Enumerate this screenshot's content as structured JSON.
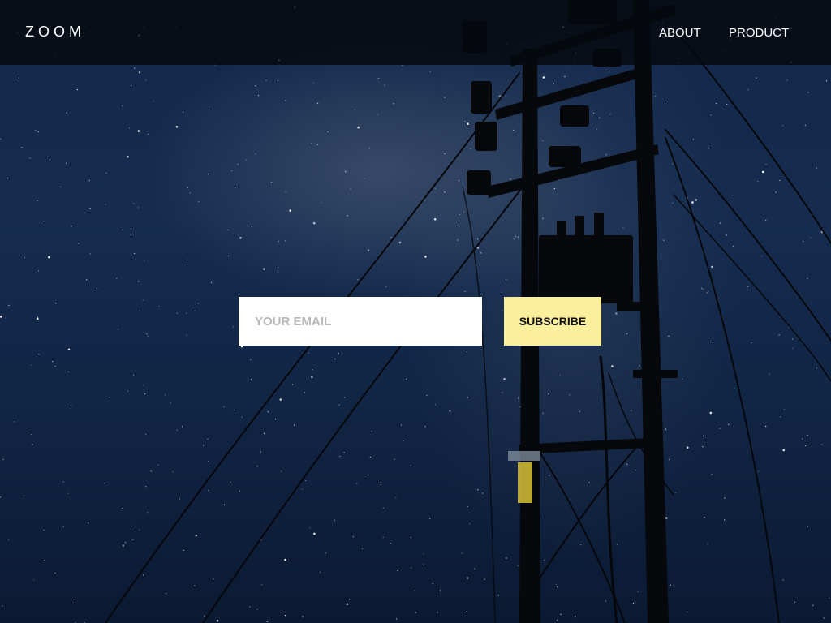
{
  "header": {
    "logo": "ZOOM",
    "nav": [
      {
        "label": "ABOUT"
      },
      {
        "label": "PRODUCT"
      }
    ]
  },
  "signup": {
    "email_placeholder": "YOUR EMAIL",
    "email_value": "",
    "subscribe_label": "SUBSCRIBE"
  },
  "colors": {
    "navbar_bg": "#05080c",
    "sky": "#13284a",
    "button_bg": "#fbef9e",
    "input_bg": "#ffffff"
  },
  "background": {
    "subject": "night sky with milky way and utility pole silhouette"
  }
}
